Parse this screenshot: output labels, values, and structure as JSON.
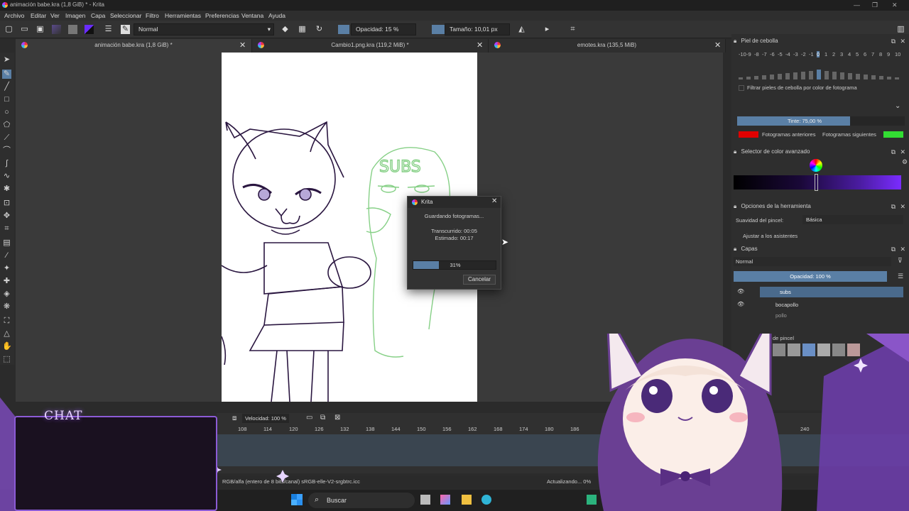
{
  "window": {
    "title": "animación babe.kra (1,8 GiB) * - Krita"
  },
  "menu": [
    "Archivo",
    "Editar",
    "Ver",
    "Imagen",
    "Capa",
    "Seleccionar",
    "Filtro",
    "Herramientas",
    "Preferencias",
    "Ventana",
    "Ayuda"
  ],
  "toolbar": {
    "blend_mode": "Normal",
    "opacity": "Opacidad: 15 %",
    "size": "Tamaño: 10,01 px"
  },
  "tabs": [
    {
      "label": "animación babe.kra (1,8 GiB) *"
    },
    {
      "label": "Cambio1.png.kra (119,2 MiB) *"
    },
    {
      "label": "emotes.kra (135,5 MiB)"
    }
  ],
  "onion_panel": {
    "title": "Piel de cebolla",
    "frames": [
      "-10",
      "-9",
      "-8",
      "-7",
      "-6",
      "-5",
      "-4",
      "-3",
      "-2",
      "-1",
      "0",
      "1",
      "2",
      "3",
      "4",
      "5",
      "6",
      "7",
      "8",
      "9",
      "10"
    ],
    "filter_label": "Filtrar pieles de cebolla por color de fotograma",
    "tint": "Tinte: 75,00 %",
    "prev_label": "Fotogramas anteriores",
    "next_label": "Fotogramas siguientes",
    "prev_color": "#e00000",
    "next_color": "#33dd33",
    "tint_value": 0.75
  },
  "color_panel": {
    "title": "Selector de color avanzado"
  },
  "tool_options": {
    "title": "Opciones de la herramienta",
    "smoothing_label": "Suavidad del pincel:",
    "smoothing_value": "Básica",
    "assist_label": "Ajustar a los asistentes"
  },
  "layers": {
    "title": "Capas",
    "blend": "Normal",
    "opacity": "Opacidad:  100 %",
    "items": [
      {
        "name": "subs"
      },
      {
        "name": "bocapollo"
      },
      {
        "name": "pollo"
      }
    ]
  },
  "brush_presets": {
    "title_fragment": "de pincel"
  },
  "dialog": {
    "title": "Krita",
    "message": "Guardando fotogramas...",
    "elapsed": "Transcurrido: 00:05",
    "estimated": "Estimado: 00:17",
    "progress_text": "31%",
    "progress": 0.31,
    "cancel": "Cancelar"
  },
  "timeline": {
    "speed": "Velocidad: 100 %",
    "frames": [
      "108",
      "114",
      "120",
      "126",
      "132",
      "138",
      "144",
      "150",
      "156",
      "162",
      "168",
      "174",
      "180",
      "186",
      "240"
    ]
  },
  "status": {
    "colorspace": "RGB/alfa (entero de 8 bits/canal)  sRGB-elle-V2-srgbtrc.icc",
    "updating": "Actualizando... 0%"
  },
  "taskbar": {
    "search": "Buscar"
  },
  "overlay": {
    "chat_title": "CHAT"
  },
  "colors": {
    "accent": "#5a7fa5",
    "chat_border": "#8c5bd6"
  }
}
